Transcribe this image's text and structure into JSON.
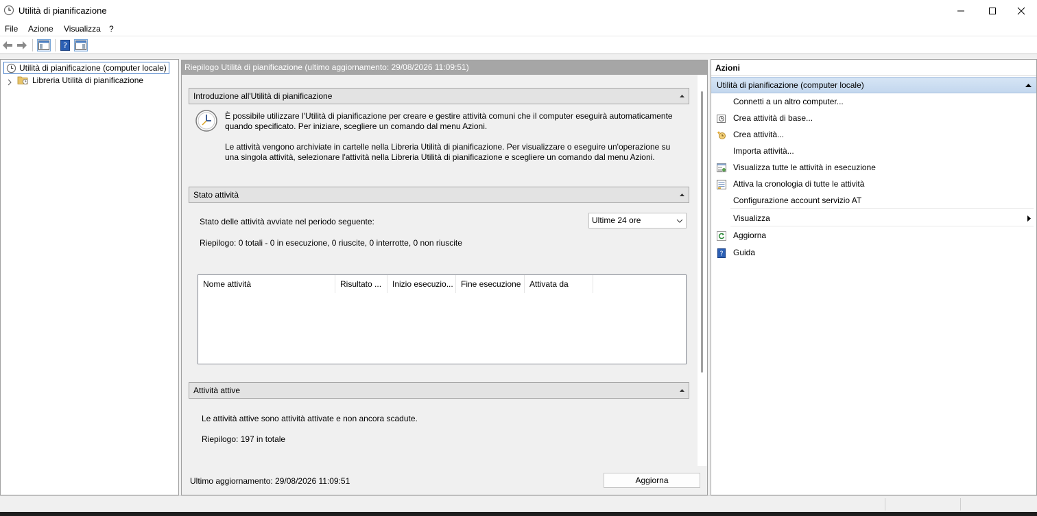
{
  "window": {
    "title": "Utilità di pianificazione"
  },
  "menu": [
    "File",
    "Azione",
    "Visualizza",
    "?"
  ],
  "tree": {
    "root": "Utilità di pianificazione (computer locale)",
    "child": "Libreria Utilità di pianificazione"
  },
  "center": {
    "header": "Riepilogo Utilità di pianificazione (ultimo aggiornamento: 29/08/2026 11:09:51)",
    "intro": {
      "title": "Introduzione all'Utilità di pianificazione",
      "p1": "È possibile utilizzare l'Utilità di pianificazione per creare e gestire attività comuni che il computer eseguirà automaticamente quando specificato. Per iniziare, scegliere un comando dal menu Azioni.",
      "p2": "Le attività vengono archiviate in cartelle nella Libreria Utilità di pianificazione. Per visualizzare o eseguire un'operazione su una singola attività, selezionare l'attività nella Libreria Utilità di pianificazione e scegliere un comando dal menu Azioni."
    },
    "status": {
      "title": "Stato attività",
      "period_label": "Stato delle attività avviate nel periodo seguente:",
      "period_value": "Ultime 24 ore",
      "summary": "Riepilogo: 0 totali - 0 in esecuzione, 0 riuscite, 0 interrotte, 0 non riuscite",
      "columns": [
        "Nome attività",
        "Risultato ...",
        "Inizio esecuzio...",
        "Fine esecuzione",
        "Attivata da"
      ]
    },
    "active": {
      "title": "Attività attive",
      "description": "Le attività attive sono attività attivate e non ancora scadute.",
      "summary": "Riepilogo: 197 in totale"
    },
    "footer": {
      "last_update": "Ultimo aggiornamento: 29/08/2026 11:09:51",
      "refresh_label": "Aggiorna"
    }
  },
  "actions": {
    "header": "Azioni",
    "section": "Utilità di pianificazione (computer locale)",
    "items": [
      {
        "label": "Connetti a un altro computer...",
        "icon": "none"
      },
      {
        "label": "Crea attività di base...",
        "icon": "clock-task-icon"
      },
      {
        "label": "Crea attività...",
        "icon": "new-task-icon"
      },
      {
        "label": "Importa attività...",
        "icon": "none"
      },
      {
        "label": "Visualizza tutte le attività in esecuzione",
        "icon": "running-tasks-icon"
      },
      {
        "label": "Attiva la cronologia di tutte le attività",
        "icon": "history-icon"
      },
      {
        "label": "Configurazione account servizio AT",
        "icon": "none"
      },
      {
        "label": "Visualizza",
        "icon": "none"
      },
      {
        "label": "Aggiorna",
        "icon": "refresh-icon"
      },
      {
        "label": "Guida",
        "icon": "help-icon"
      }
    ]
  }
}
